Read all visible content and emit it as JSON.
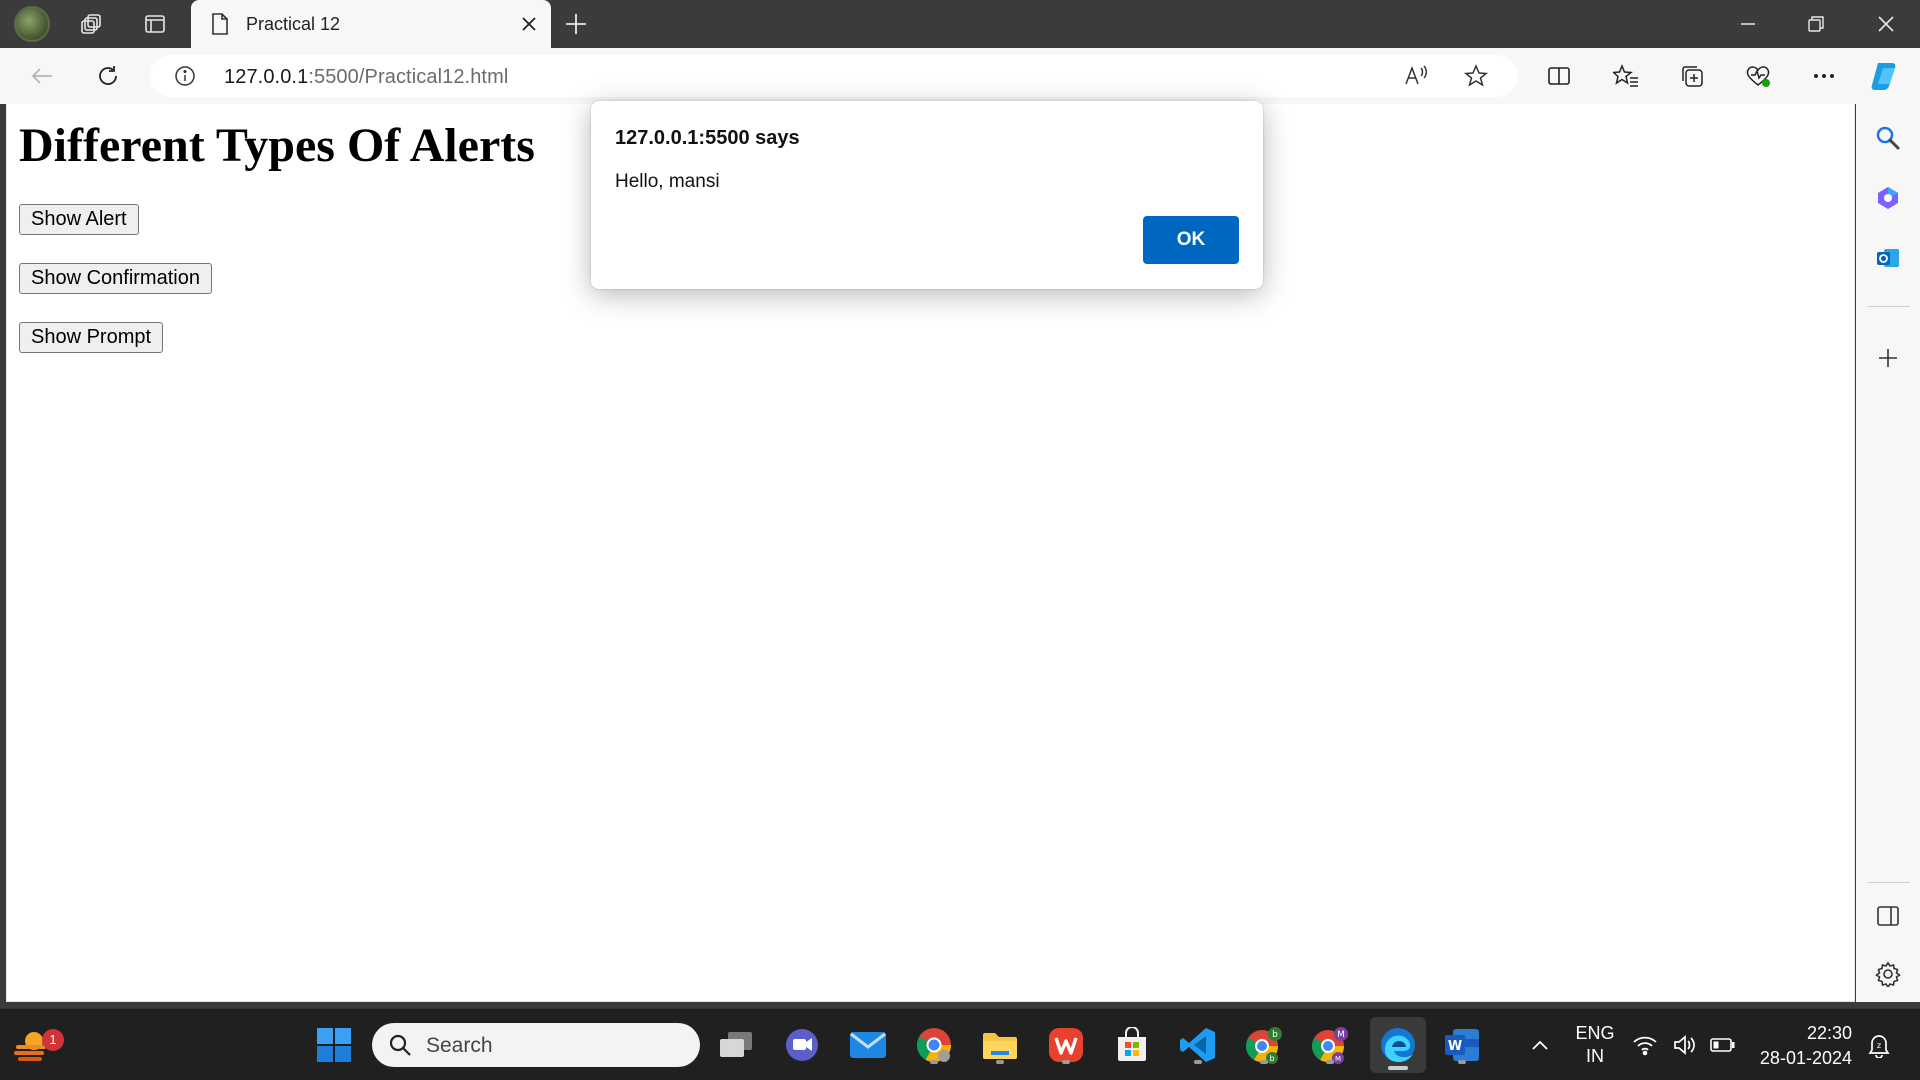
{
  "browser": {
    "tab": {
      "title": "Practical 12"
    },
    "url": {
      "host": "127.0.0.1",
      "rest": ":5500/Practical12.html"
    }
  },
  "page": {
    "heading": "Different Types Of Alerts",
    "buttons": [
      "Show Alert",
      "Show Confirmation",
      "Show Prompt"
    ]
  },
  "dialog": {
    "title": "127.0.0.1:5500 says",
    "message": "Hello, mansi",
    "ok_label": "OK",
    "accent": "#0067c0"
  },
  "taskbar": {
    "search_placeholder": "Search",
    "notification_count": "1",
    "language": "ENG",
    "region": "IN",
    "time": "22:30",
    "date": "28-01-2024"
  }
}
